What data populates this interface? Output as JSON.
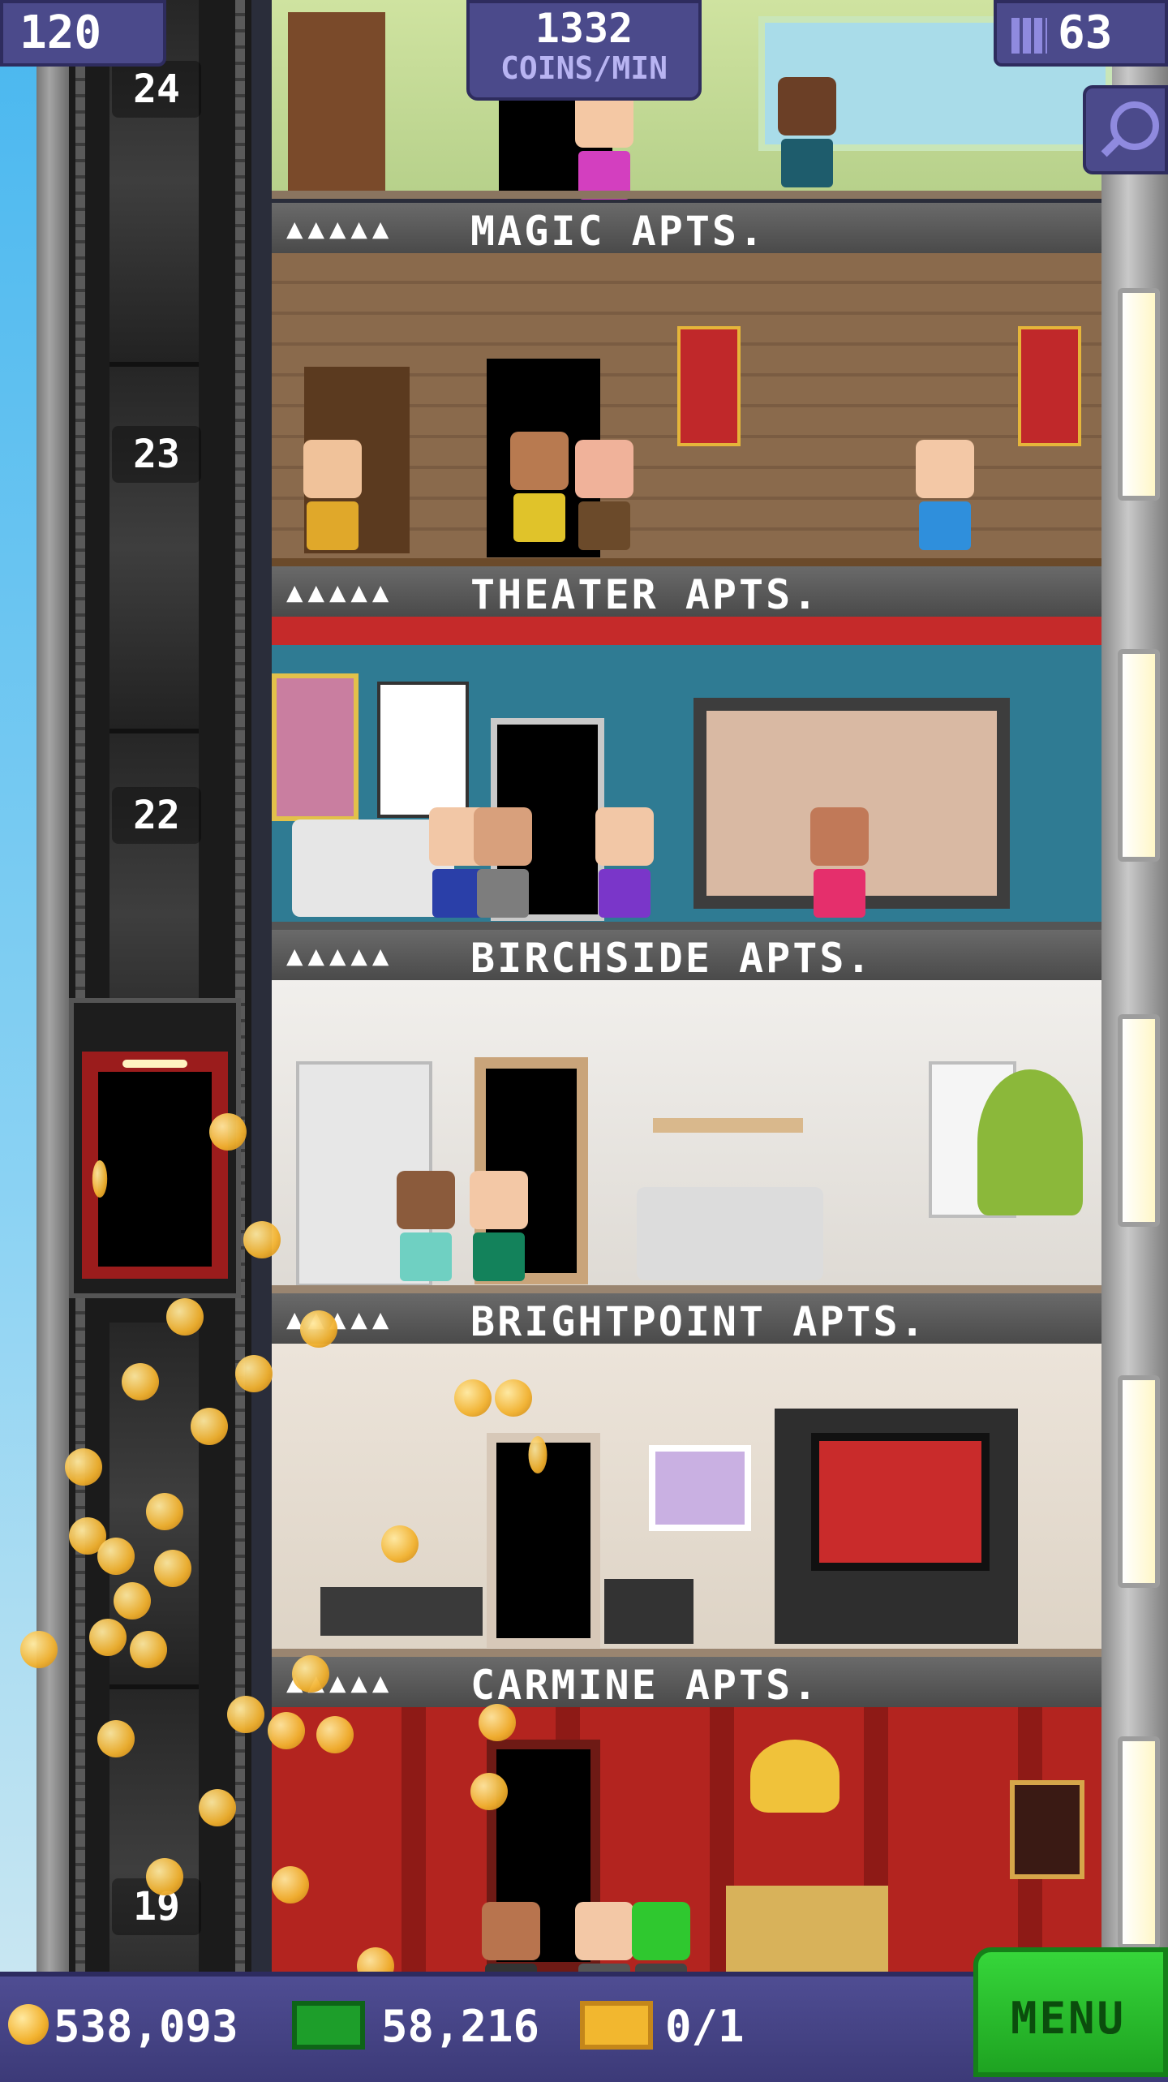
{
  "hud": {
    "population": "120",
    "coins_per_min_value": "1332",
    "coins_per_min_label": "COINS/MIN",
    "floors_count": "63"
  },
  "elevator": {
    "floor_numbers": [
      "24",
      "23",
      "22",
      "19"
    ]
  },
  "floors": [
    {
      "name": "MAGIC APTS.",
      "people_icons": "▲▲▲▲▲",
      "color": "#8a6a4c"
    },
    {
      "name": "THEATER APTS.",
      "people_icons": "▲▲▲▲▲",
      "color": "#2f7b93"
    },
    {
      "name": "BIRCHSIDE APTS.",
      "people_icons": "▲▲▲▲▲",
      "color": "#e9e6e2"
    },
    {
      "name": "BRIGHTPOINT APTS.",
      "people_icons": "▲▲▲▲▲",
      "color": "#e6ddd2"
    },
    {
      "name": "CARMINE APTS.",
      "people_icons": "▲▲▲▲▲",
      "color": "#b3241f"
    }
  ],
  "bottom_bar": {
    "coins": "538,093",
    "bux": "58,216",
    "tickets": "0/1",
    "menu_label": "MENU"
  },
  "colors": {
    "hud_bg": "#4b4a8b",
    "menu_green": "#2ec531",
    "coin_gold": "#f2b22f"
  }
}
